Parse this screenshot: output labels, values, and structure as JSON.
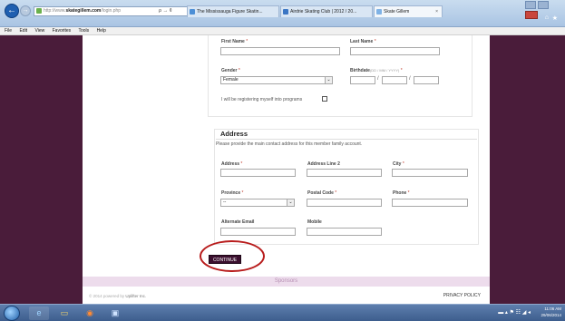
{
  "browser": {
    "address_prefix": "http://www.",
    "address_domain": "skategillem.com",
    "address_path": "/login.php",
    "address_tools": "ρ → ¢",
    "tabs": [
      {
        "label": "The Mississauga Figure Skatin...",
        "color": "#4c8fd6"
      },
      {
        "label": "Airdrie Skating Club | 2012 / 20...",
        "color": "#3b76c4"
      },
      {
        "label": "Skate Gillem",
        "color": "#7fb2e5"
      }
    ],
    "tab_close": "×",
    "back_glyph": "←",
    "fwd_glyph": "→"
  },
  "menu": [
    "File",
    "Edit",
    "View",
    "Favorites",
    "Tools",
    "Help"
  ],
  "form": {
    "first_name_label": "First Name",
    "last_name_label": "Last Name",
    "required_mark": "*",
    "gender_label": "Gender",
    "gender_value": "Female",
    "birthdate_label": "Birthdate",
    "birthdate_hint": "(DD / MM / YYYY)",
    "birth_sep": "/",
    "programs_text": "I will be registering myself into programs",
    "dropdown_arrow": "⌄"
  },
  "address": {
    "title": "Address",
    "description": "Please provide the main contact address for this member family account.",
    "address_label": "Address",
    "address2_label": "Address Line 2",
    "city_label": "City",
    "province_label": "Province",
    "province_value": "--",
    "postal_label": "Postal Code",
    "phone_label": "Phone",
    "alt_email_label": "Alternate Email",
    "mobile_label": "Mobile"
  },
  "continue_label": "CONTINUE",
  "sponsors_label": "Sponsors",
  "footer": {
    "copyright": "© 2014 powered by ",
    "powered_by": "Uplifter Inc.",
    "privacy": "PRIVACY POLICY"
  },
  "taskbar": {
    "tray_icons": "▬ ▴ ⚑ ☷ ◢ ◂",
    "time": "11:06 AM",
    "date": "29/06/2014"
  },
  "colors": {
    "accent": "#3b0f2e",
    "background": "#4a1c3a",
    "highlight_oval": "#b81c1c",
    "sponsors_band": "#eddcec"
  }
}
